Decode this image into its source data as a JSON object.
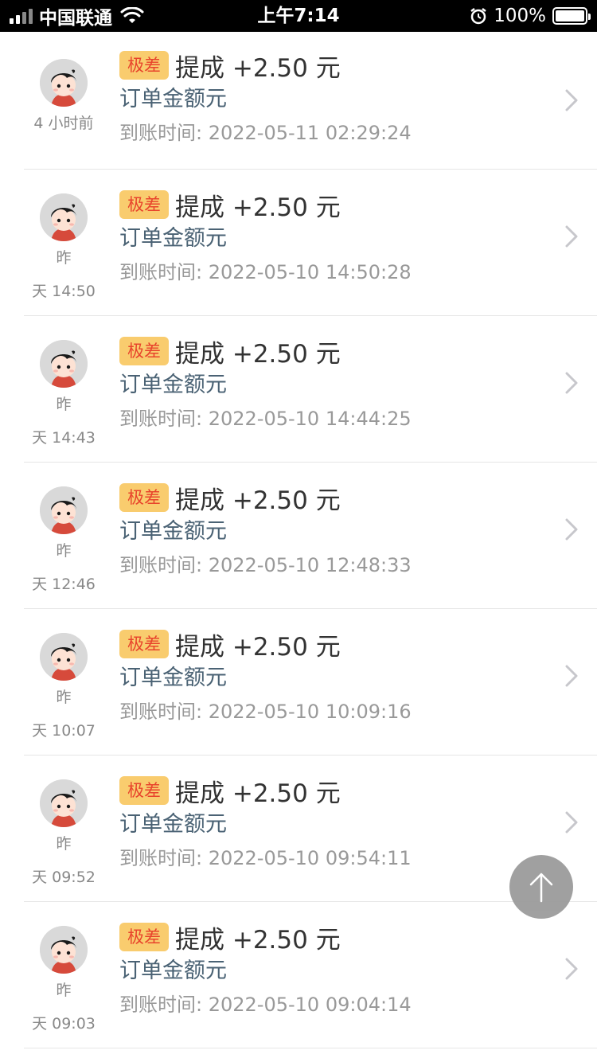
{
  "status_bar": {
    "carrier": "中国联通",
    "time": "上午7:14",
    "battery": "100%"
  },
  "list": [
    {
      "badge": "极差",
      "title": "提成 +2.50 元",
      "sub": "订单金额元",
      "datetime": "到账时间: 2022-05-11 02:29:24",
      "time_line1": "4 小时前",
      "time_line2": ""
    },
    {
      "badge": "极差",
      "title": "提成 +2.50 元",
      "sub": "订单金额元",
      "datetime": "到账时间: 2022-05-10 14:50:28",
      "time_line1": "昨",
      "time_line2": "天 14:50"
    },
    {
      "badge": "极差",
      "title": "提成 +2.50 元",
      "sub": "订单金额元",
      "datetime": "到账时间: 2022-05-10 14:44:25",
      "time_line1": "昨",
      "time_line2": "天 14:43"
    },
    {
      "badge": "极差",
      "title": "提成 +2.50 元",
      "sub": "订单金额元",
      "datetime": "到账时间: 2022-05-10 12:48:33",
      "time_line1": "昨",
      "time_line2": "天 12:46"
    },
    {
      "badge": "极差",
      "title": "提成 +2.50 元",
      "sub": "订单金额元",
      "datetime": "到账时间: 2022-05-10 10:09:16",
      "time_line1": "昨",
      "time_line2": "天 10:07"
    },
    {
      "badge": "极差",
      "title": "提成 +2.50 元",
      "sub": "订单金额元",
      "datetime": "到账时间: 2022-05-10 09:54:11",
      "time_line1": "昨",
      "time_line2": "天 09:52"
    },
    {
      "badge": "极差",
      "title": "提成 +2.50 元",
      "sub": "订单金额元",
      "datetime": "到账时间: 2022-05-10 09:04:14",
      "time_line1": "昨",
      "time_line2": "天 09:03"
    }
  ],
  "colors": {
    "badge_bg": "#f9cc6e",
    "badge_text": "#e8442c",
    "fab_bg": "#999999"
  },
  "icons": {
    "list_item_chevron": "chevron-right-icon",
    "fab": "arrow-up-icon"
  }
}
